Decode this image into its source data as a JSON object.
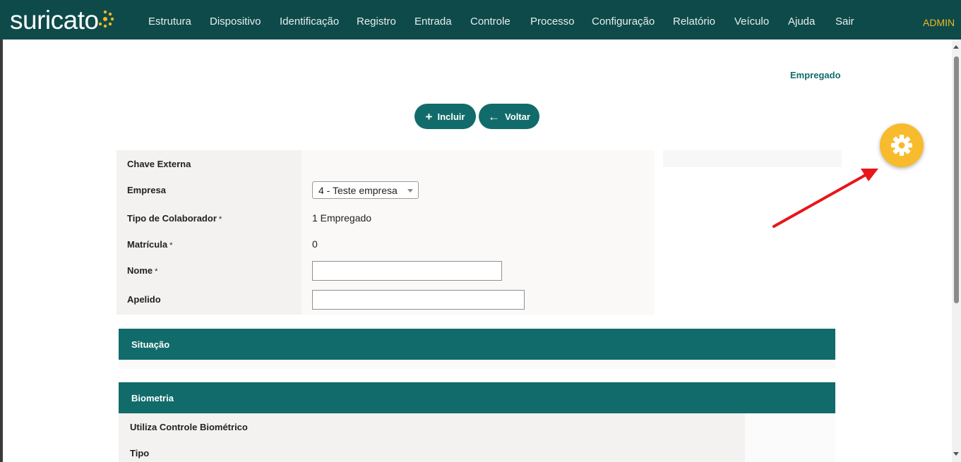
{
  "app": {
    "logo_text": "suricato"
  },
  "nav": {
    "items": [
      "Estrutura",
      "Dispositivo",
      "Identificação",
      "Registro",
      "Entrada",
      "Controle",
      "Processo",
      "Configuração",
      "Relatório",
      "Veículo",
      "Ajuda",
      "Sair"
    ],
    "user": "ADMIN"
  },
  "page": {
    "label": "Empregado"
  },
  "toolbar": {
    "include_label": "Incluir",
    "include_icon": "plus-icon",
    "back_label": "Voltar",
    "back_icon": "arrow-left-icon"
  },
  "form": {
    "required_mark": "*",
    "chave_externa": {
      "label": "Chave Externa"
    },
    "empresa": {
      "label": "Empresa",
      "value": "4 - Teste empresa"
    },
    "tipo_colaborador": {
      "label": "Tipo de Colaborador",
      "value": "1 Empregado"
    },
    "matricula": {
      "label": "Matrícula",
      "value": "0"
    },
    "nome": {
      "label": "Nome",
      "value": ""
    },
    "apelido": {
      "label": "Apelido",
      "value": ""
    }
  },
  "sections": {
    "situacao": "Situação",
    "biometria": "Biometria"
  },
  "biometria": {
    "utiliza_label": "Utiliza Controle Biométrico",
    "tipo_label": "Tipo"
  },
  "fab": {
    "icon": "gear-icon"
  },
  "colors": {
    "nav_bg": "#0e4a4a",
    "accent": "#126b6b",
    "admin": "#f0b722",
    "fab": "#f7bb2c",
    "annotation_arrow": "#e8151b"
  }
}
